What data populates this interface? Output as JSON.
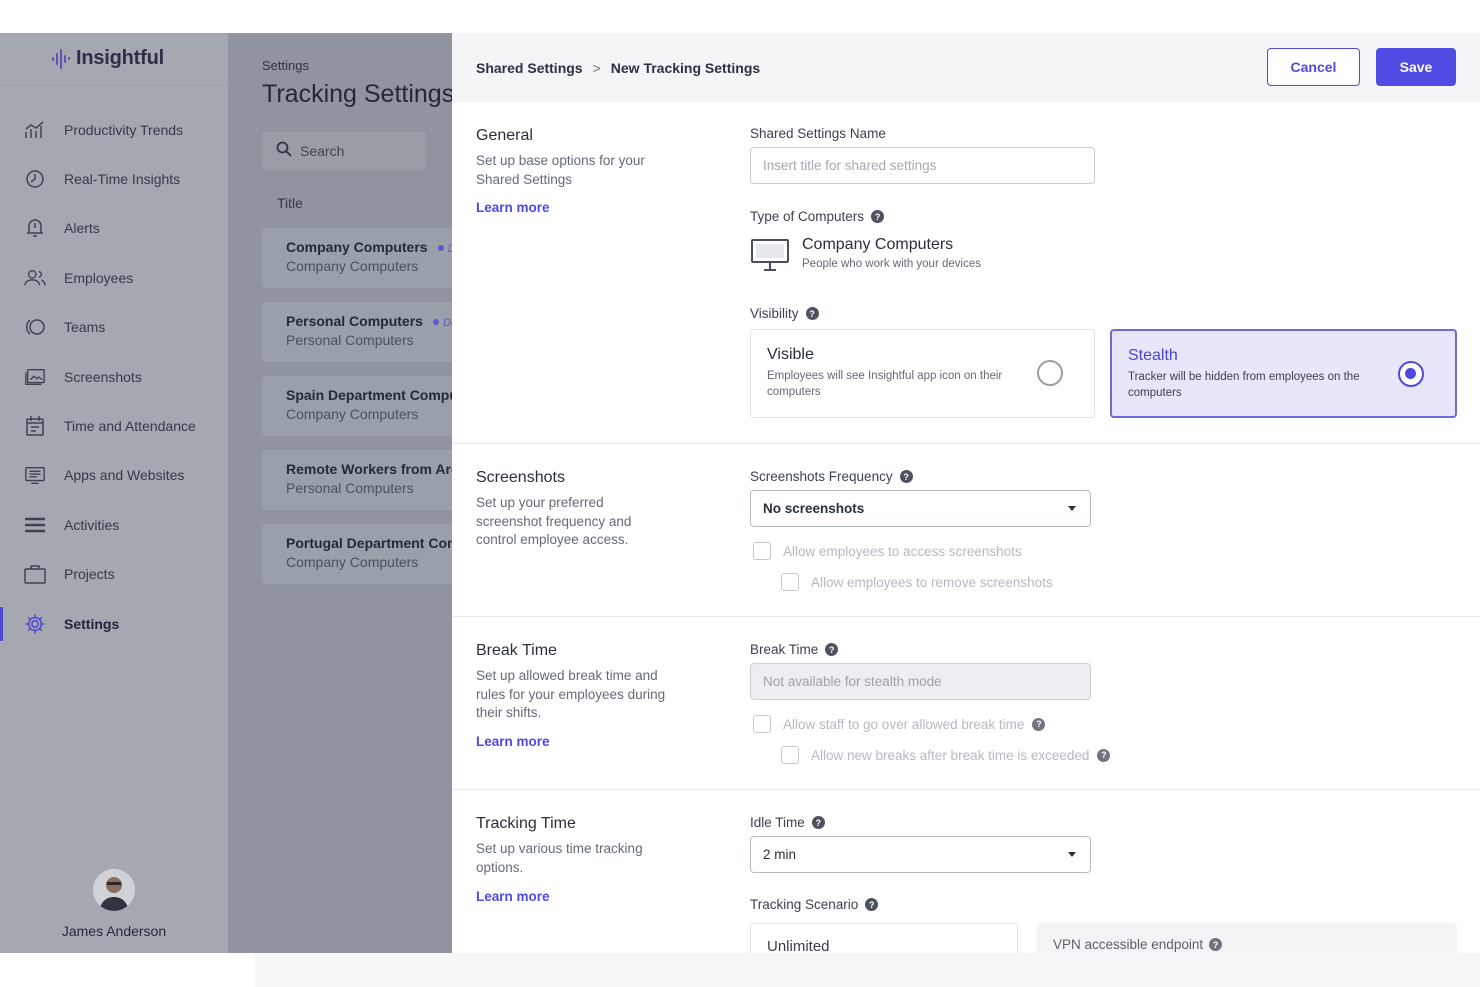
{
  "sidebar": {
    "logo_text": "Insightful",
    "items": [
      {
        "label": "Productivity Trends",
        "icon": "chart-trend-icon"
      },
      {
        "label": "Real-Time Insights",
        "icon": "clock-icon"
      },
      {
        "label": "Alerts",
        "icon": "bell-icon"
      },
      {
        "label": "Employees",
        "icon": "people-icon"
      },
      {
        "label": "Teams",
        "icon": "teams-icon"
      },
      {
        "label": "Screenshots",
        "icon": "image-icon"
      },
      {
        "label": "Time and Attendance",
        "icon": "calendar-icon"
      },
      {
        "label": "Apps and Websites",
        "icon": "monitor-list-icon"
      },
      {
        "label": "Activities",
        "icon": "list-icon"
      },
      {
        "label": "Projects",
        "icon": "briefcase-icon"
      },
      {
        "label": "Settings",
        "icon": "gear-icon",
        "active": true
      }
    ],
    "user_name": "James Anderson"
  },
  "list_panel": {
    "breadcrumb": "Settings",
    "title": "Tracking Settings",
    "search_placeholder": "Search",
    "column_title": "Title",
    "items": [
      {
        "name": "Company Computers",
        "sub": "Company Computers",
        "default_tag": "De"
      },
      {
        "name": "Personal Computers",
        "sub": "Personal Computers",
        "default_tag": "Def"
      },
      {
        "name": "Spain Department Comput",
        "sub": "Company Computers"
      },
      {
        "name": "Remote Workers from Arge",
        "sub": "Personal Computers"
      },
      {
        "name": "Portugal Department Com",
        "sub": "Company Computers"
      }
    ]
  },
  "main": {
    "breadcrumb": {
      "parent": "Shared Settings",
      "separator": ">",
      "current": "New Tracking Settings"
    },
    "cancel_label": "Cancel",
    "save_label": "Save",
    "general": {
      "title": "General",
      "description": "Set up base options for your Shared Settings",
      "learn_more": "Learn more",
      "name_label": "Shared Settings Name",
      "name_placeholder": "Insert title for shared settings",
      "computers_label": "Type of Computers",
      "computer_type_title": "Company Computers",
      "computer_type_sub": "People who work with your devices",
      "visibility_label": "Visibility",
      "visible_title": "Visible",
      "visible_desc": "Employees will see Insightful app icon on their computers",
      "stealth_title": "Stealth",
      "stealth_desc": "Tracker will be hidden from employees on the computers",
      "selected": "Stealth"
    },
    "screenshots": {
      "title": "Screenshots",
      "description": "Set up your preferred screenshot frequency and control employee access.",
      "frequency_label": "Screenshots Frequency",
      "frequency_value": "No screenshots",
      "allow_access": "Allow employees to access screenshots",
      "allow_remove": "Allow employees to remove screenshots"
    },
    "break_time": {
      "title": "Break Time",
      "description": "Set up allowed break time and rules for your employees during their shifts.",
      "learn_more": "Learn more",
      "label": "Break Time",
      "value": "Not available for stealth mode",
      "allow_over": "Allow staff to go over allowed break time",
      "allow_new": "Allow new breaks after break time is exceeded"
    },
    "tracking_time": {
      "title": "Tracking Time",
      "description": "Set up various time tracking options.",
      "learn_more": "Learn more",
      "idle_label": "Idle Time",
      "idle_value": "2 min",
      "scenario_label": "Tracking Scenario",
      "scenario_value": "Unlimited",
      "vpn_label": "VPN accessible endpoint"
    }
  },
  "colors": {
    "accent": "#4f4be3",
    "sidebar_bg": "#a3a8b1",
    "stealth_bg": "#e7e6fb"
  }
}
